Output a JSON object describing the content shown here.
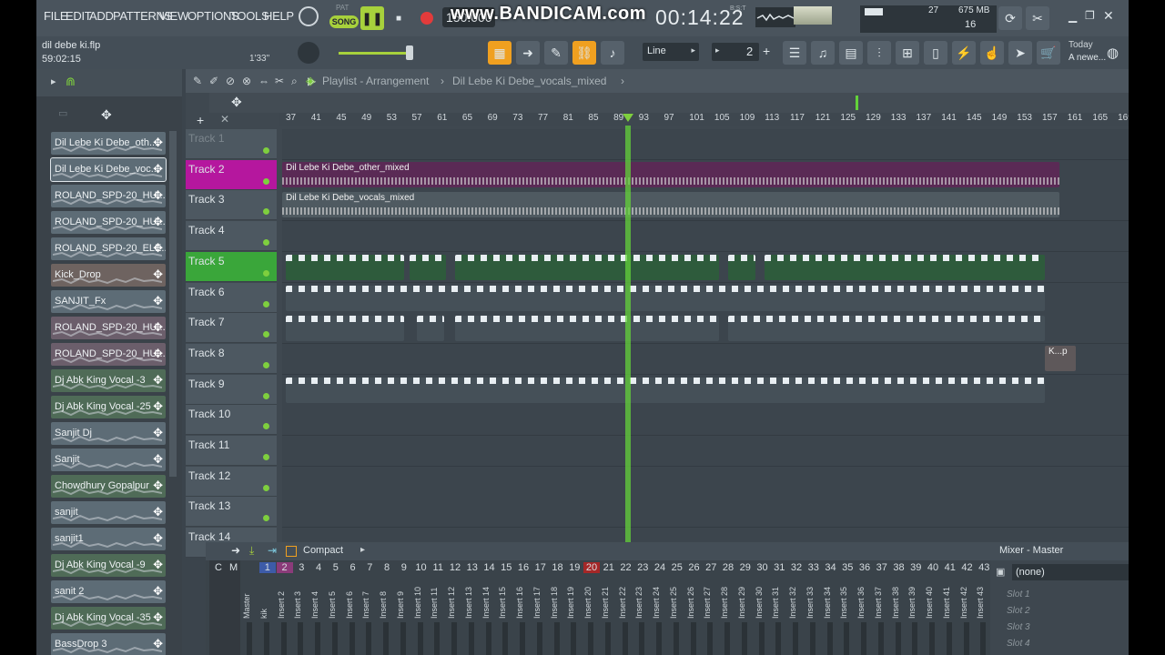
{
  "overlay": {
    "recorder_watermark": "www.BANDICAM.com"
  },
  "menu": [
    "FILE",
    "EDIT",
    "ADD",
    "PATTERNS",
    "VIEW",
    "OPTIONS",
    "TOOLS",
    "HELP"
  ],
  "project": {
    "file": "dil debe ki.flp",
    "time": "59:02:15",
    "length": "1'33\""
  },
  "transport": {
    "mode_pat": "PAT",
    "mode_song": "SONG",
    "tempo": "150.000",
    "clock": "00:14:22",
    "clock_label": "B:S:T"
  },
  "cpu": {
    "value": "27",
    "memory": "675 MB",
    "voices": "16"
  },
  "snap": {
    "label": "Line",
    "pattern_num": "2"
  },
  "news": {
    "line1": "Today",
    "line2": "A newe..."
  },
  "playlist": {
    "title": "Playlist - Arrangement",
    "arrow": "›",
    "pattern": "Dil Lebe Ki Debe_vocals_mixed"
  },
  "ruler": [
    "37",
    "41",
    "45",
    "49",
    "53",
    "57",
    "61",
    "65",
    "69",
    "73",
    "77",
    "81",
    "85",
    "89",
    "93",
    "97",
    "101",
    "105",
    "109",
    "113",
    "117",
    "121",
    "125",
    "129",
    "133",
    "137",
    "141",
    "145",
    "149",
    "153",
    "157",
    "161",
    "165",
    "169"
  ],
  "tracks": [
    "Track 1",
    "Track 2",
    "Track 3",
    "Track 4",
    "Track 5",
    "Track 6",
    "Track 7",
    "Track 8",
    "Track 9",
    "Track 10",
    "Track 11",
    "Track 12",
    "Track 13",
    "Track 14"
  ],
  "clips": {
    "other": "Dil Lebe Ki Debe_other_mixed",
    "vocals": "Dil Lebe Ki Debe_vocals_mixed",
    "kp": "K...p"
  },
  "browser": [
    {
      "label": "Dil Lebe Ki Debe_oth...",
      "color": "#5d6c76"
    },
    {
      "label": "Dil Lebe Ki Debe_voc...",
      "color": "#5d6c76"
    },
    {
      "label": "ROLAND_SPD-20_HU...",
      "color": "#5d6c76"
    },
    {
      "label": "ROLAND_SPD-20_HU...",
      "color": "#5d6c76"
    },
    {
      "label": "ROLAND_SPD-20_ELE...",
      "color": "#5d6c76"
    },
    {
      "label": "Kick_Drop",
      "color": "#6e6360"
    },
    {
      "label": "SANJIT_Fx",
      "color": "#5d6c76"
    },
    {
      "label": "ROLAND_SPD-20_HU...",
      "color": "#6b5e6b"
    },
    {
      "label": "ROLAND_SPD-20_HU...",
      "color": "#6b5e6b"
    },
    {
      "label": "Dj Abk King Vocal -3",
      "color": "#4f6b57"
    },
    {
      "label": "Dj Abk King Vocal -25",
      "color": "#4f6b57"
    },
    {
      "label": "Sanjit Dj",
      "color": "#5d6c76"
    },
    {
      "label": "Sanjit",
      "color": "#5d6c76"
    },
    {
      "label": "Chowdhury Gopalpur",
      "color": "#4f6b57"
    },
    {
      "label": "sanjit",
      "color": "#5d6c76"
    },
    {
      "label": "sanjit1",
      "color": "#5d6c76"
    },
    {
      "label": "Dj Abk King Vocal -9",
      "color": "#4f6b57"
    },
    {
      "label": "sanit 2",
      "color": "#5d6c76"
    },
    {
      "label": "Dj Abk King Vocal -35",
      "color": "#4f6b57"
    },
    {
      "label": "BassDrop 3",
      "color": "#5d6c76"
    }
  ],
  "mixer": {
    "view": "Compact",
    "title": "Mixer - Master",
    "slot_none": "(none)",
    "slots": [
      "Slot 1",
      "Slot 2",
      "Slot 3",
      "Slot 4"
    ],
    "header_c": "C",
    "header_m": "M",
    "numbers": [
      "1",
      "2",
      "3",
      "4",
      "5",
      "6",
      "7",
      "8",
      "9",
      "10",
      "11",
      "12",
      "13",
      "14",
      "15",
      "16",
      "17",
      "18",
      "19",
      "20",
      "21",
      "22",
      "23",
      "24",
      "25",
      "26",
      "27",
      "28",
      "29",
      "30",
      "31",
      "32",
      "33",
      "34",
      "35",
      "36",
      "37",
      "38",
      "39",
      "40",
      "41",
      "42",
      "43"
    ],
    "names": [
      "Master",
      "kik",
      "Insert 2",
      "Insert 3",
      "Insert 4",
      "Insert 5",
      "Insert 6",
      "Insert 7",
      "Insert 8",
      "Insert 9",
      "Insert 10",
      "Insert 11",
      "Insert 12",
      "Insert 13",
      "Insert 14",
      "Insert 15",
      "Insert 16",
      "Insert 17",
      "Insert 18",
      "Insert 19",
      "Insert 20",
      "Insert 21",
      "Insert 22",
      "Insert 23",
      "Insert 24",
      "Insert 25",
      "Insert 26",
      "Insert 27",
      "Insert 28",
      "Insert 29",
      "Insert 30",
      "Insert 31",
      "Insert 32",
      "Insert 33",
      "Insert 34",
      "Insert 35",
      "Insert 36",
      "Insert 37",
      "Insert 38",
      "Insert 39",
      "Insert 40",
      "Insert 41",
      "Insert 42",
      "Insert 43"
    ]
  },
  "colors": {
    "track2": "#b5179e",
    "track5": "#3aa63a",
    "playhead": "#63d23a",
    "accent": "#f0a020"
  }
}
